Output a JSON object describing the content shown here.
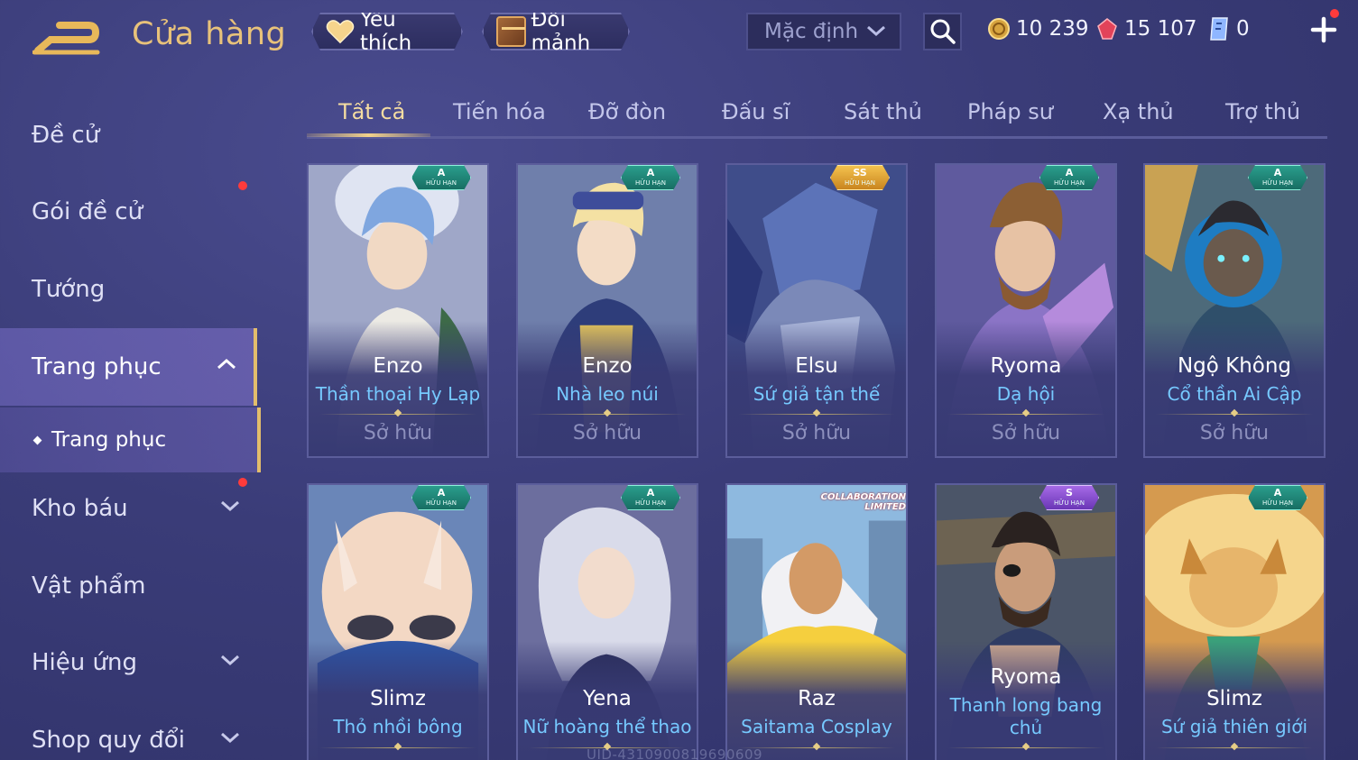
{
  "header": {
    "title": "Cửa hàng",
    "favorites_label": "Yêu thích",
    "exchange_label": "Đổi mảnh",
    "sort_value": "Mặc định",
    "currencies": {
      "gold": "10 239",
      "ruby": "15 107",
      "voucher": "0"
    }
  },
  "sidebar": {
    "items": [
      {
        "label": "Đề cử"
      },
      {
        "label": "Gói đề cử"
      },
      {
        "label": "Tướng"
      },
      {
        "label": "Trang phục"
      },
      {
        "label": "Kho báu"
      },
      {
        "label": "Vật phẩm"
      },
      {
        "label": "Hiệu ứng"
      },
      {
        "label": "Shop quy đổi"
      }
    ],
    "sub_item": "Trang phục"
  },
  "tabs": [
    "Tất cả",
    "Tiến hóa",
    "Đỡ đòn",
    "Đấu sĩ",
    "Sát thủ",
    "Pháp sư",
    "Xạ thủ",
    "Trợ thủ"
  ],
  "badge_text": {
    "limited": "HỮU HẠN",
    "collab_1": "COLLABORATION",
    "collab_2": "LIMITED"
  },
  "cards": [
    {
      "hero": "Enzo",
      "skin": "Thần thoại Hy Lạp",
      "status": "Sở hữu",
      "rank": "A"
    },
    {
      "hero": "Enzo",
      "skin": "Nhà leo núi",
      "status": "Sở hữu",
      "rank": "A"
    },
    {
      "hero": "Elsu",
      "skin": "Sứ giả tận thế",
      "status": "Sở hữu",
      "rank": "SS"
    },
    {
      "hero": "Ryoma",
      "skin": "Dạ hội",
      "status": "Sở hữu",
      "rank": "A"
    },
    {
      "hero": "Ngộ Không",
      "skin": "Cổ thần Ai Cập",
      "status": "Sở hữu",
      "rank": "A"
    },
    {
      "hero": "Slimz",
      "skin": "Thỏ nhồi bông",
      "rank": "A"
    },
    {
      "hero": "Yena",
      "skin": "Nữ hoàng thể thao",
      "rank": "A"
    },
    {
      "hero": "Raz",
      "skin": "Saitama Cosplay",
      "rank": ""
    },
    {
      "hero": "Ryoma",
      "skin_line1": "Thanh long bang",
      "skin_line2": "chủ",
      "rank": "S"
    },
    {
      "hero": "Slimz",
      "skin": "Sứ giả thiên giới",
      "rank": "A"
    }
  ],
  "uid_text": "UID-4310900819690609",
  "colors": {
    "accent_gold": "#e8c27a",
    "skin_name": "#76c9ff",
    "notify_red": "#ff3b3b"
  }
}
